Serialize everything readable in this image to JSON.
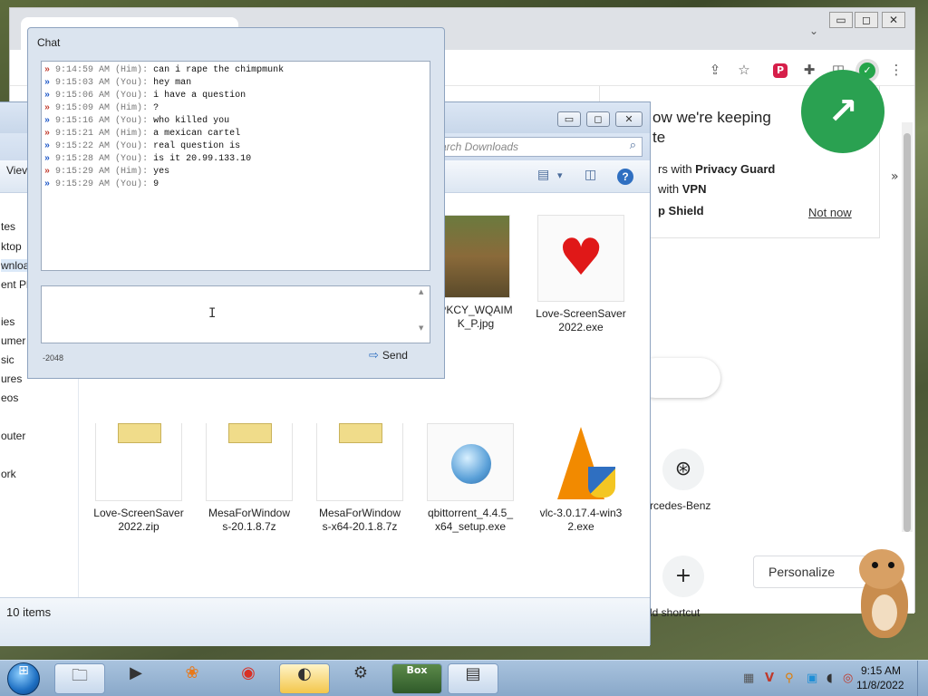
{
  "browser": {
    "window_controls": {
      "minimize": "▭",
      "maximize": "◻",
      "close": "✕"
    },
    "tab_list_icon": "⌄",
    "toolbar_icons": {
      "share": "⇪",
      "star": "☆",
      "privacy_badger": "P",
      "extensions": "✚",
      "sidepanel": "◫",
      "shield": "✓",
      "menu": "⋮"
    },
    "promo": {
      "badge": "↗",
      "heading": "ow we're keeping\nte",
      "line1_prefix": "rs with ",
      "line1_bold": "Privacy Guard",
      "line2_prefix": "with ",
      "line2_bold": "VPN",
      "line3_bold": "p Shield",
      "not_now": "Not now"
    },
    "side_chevron": "»",
    "shortcut": {
      "icon": "⊛",
      "label": "rcedes-Benz"
    },
    "add_shortcut": {
      "icon": "+",
      "label": "ld shortcut"
    },
    "personalize": "Personalize"
  },
  "explorer": {
    "window_controls": {
      "minimize": "▭",
      "maximize": "◻",
      "close": "✕"
    },
    "search_placeholder": "arch Downloads",
    "search_icon": "⌕",
    "view_menu": "Viev",
    "nav_items": [
      "tes",
      "ktop",
      "wnloa",
      "ent Pl",
      "ies",
      "umer",
      "sic",
      "ures",
      "eos",
      "outer",
      "ork"
    ],
    "cmd_icons": {
      "views": "▤",
      "views_drop": "▾",
      "preview": "◫",
      "help": "?"
    },
    "files": [
      {
        "name": "PKCY_WQAIM\nK_P.jpg"
      },
      {
        "name": "Love-ScreenSaver\n2022.exe"
      },
      {
        "name": "Love-ScreenSaver\n2022.zip"
      },
      {
        "name": "MesaForWindow\ns-20.1.8.7z"
      },
      {
        "name": "MesaForWindow\ns-x64-20.1.8.7z"
      },
      {
        "name": "qbittorrent_4.4.5_\nx64_setup.exe"
      },
      {
        "name": "vlc-3.0.17.4-win3\n2.exe"
      }
    ],
    "status": "10 items"
  },
  "chat": {
    "title": "Chat",
    "messages": [
      {
        "time": "9:14:59 AM",
        "who": "(Him)",
        "text": "can i rape the chimpmunk"
      },
      {
        "time": "9:15:03 AM",
        "who": "(You)",
        "text": "hey man"
      },
      {
        "time": "9:15:06 AM",
        "who": "(You)",
        "text": "i have a question"
      },
      {
        "time": "9:15:09 AM",
        "who": "(Him)",
        "text": "?"
      },
      {
        "time": "9:15:16 AM",
        "who": "(You)",
        "text": "who killed you"
      },
      {
        "time": "9:15:21 AM",
        "who": "(Him)",
        "text": "a mexican cartel"
      },
      {
        "time": "9:15:22 AM",
        "who": "(You)",
        "text": "real question is"
      },
      {
        "time": "9:15:28 AM",
        "who": "(You)",
        "text": "is it 20.99.133.10"
      },
      {
        "time": "9:15:29 AM",
        "who": "(Him)",
        "text": "yes"
      },
      {
        "time": "9:15:29 AM",
        "who": "(You)",
        "text": "9"
      }
    ],
    "compose_value": "",
    "counter": "-2048",
    "send_label": "Send",
    "send_icon": "⇨"
  },
  "taskbar": {
    "start_icon": "⊞",
    "buttons": [
      {
        "name": "explorer",
        "icon": "🗀"
      },
      {
        "name": "media-player",
        "icon": "▶"
      },
      {
        "name": "uc-browser",
        "icon": "❀"
      },
      {
        "name": "chrome",
        "icon": "◉"
      },
      {
        "name": "vpn",
        "icon": "◐"
      },
      {
        "name": "video-app",
        "icon": "⚙"
      },
      {
        "name": "box-app",
        "icon": "Box"
      },
      {
        "name": "chat-app",
        "icon": "▤"
      }
    ],
    "tray_icons": [
      "▦",
      "V",
      "⚲",
      "▣",
      "◖",
      "◎"
    ],
    "time": "9:15 AM",
    "date": "11/8/2022"
  }
}
